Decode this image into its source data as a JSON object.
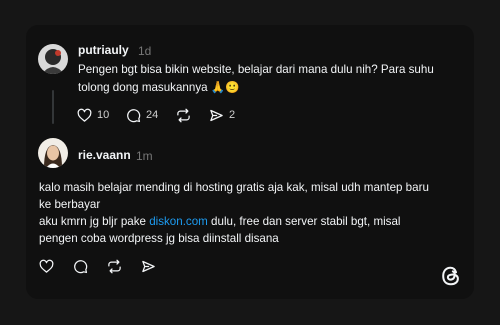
{
  "post": {
    "username": "putriauly",
    "time": "1d",
    "text_line1": "Pengen bgt bisa bikin website, belajar dari mana dulu nih? Para suhu",
    "text_line2": "tolong dong masukannya",
    "emoji": "🙏🙂",
    "likes": "10",
    "replies": "24",
    "shares": "2"
  },
  "reply": {
    "username": "rie.vaann",
    "time": "1m",
    "line1": "kalo masih belajar mending di hosting gratis aja kak, misal udh mantep baru",
    "line2": "ke berbayar",
    "line3_before": "aku kmrn jg bljr pake ",
    "line3_link": "diskon.com",
    "line3_after": " dulu, free dan server stabil bgt, misal",
    "line4": "pengen coba wordpress jg bisa diinstall disana"
  },
  "colors": {
    "background": "#161616",
    "card": "#101010",
    "link": "#1d9bf0",
    "muted": "#777777"
  },
  "icons": [
    "heart-icon",
    "comment-icon",
    "repost-icon",
    "send-icon",
    "threads-logo-icon"
  ]
}
